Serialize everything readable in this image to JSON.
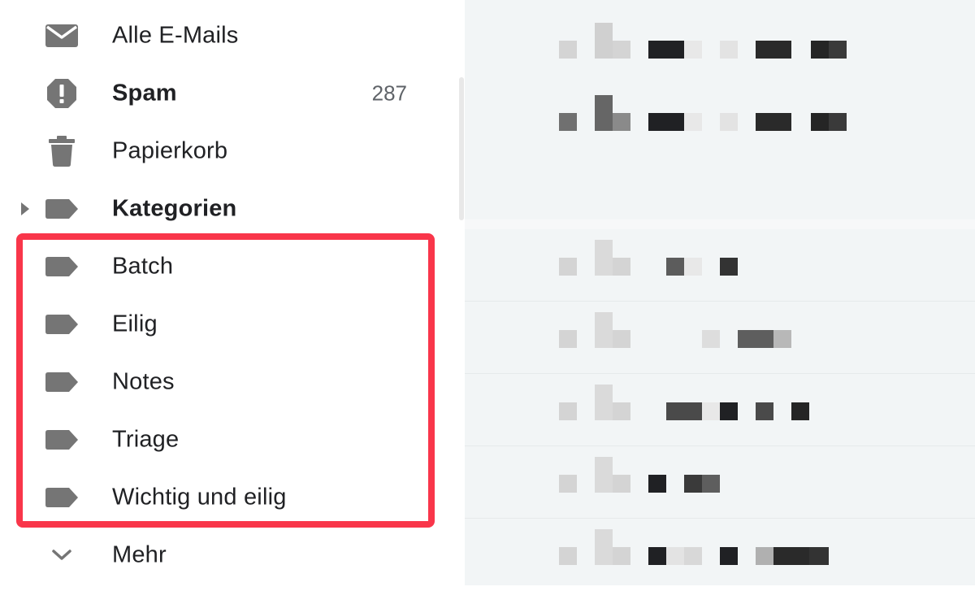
{
  "sidebar": {
    "items": [
      {
        "label": "Alle E-Mails",
        "icon": "mail-icon"
      },
      {
        "label": "Spam",
        "icon": "spam-icon",
        "count": "287",
        "bold": true
      },
      {
        "label": "Papierkorb",
        "icon": "trash-icon"
      },
      {
        "label": "Kategorien",
        "icon": "label-icon",
        "bold": true,
        "expandable": true
      },
      {
        "label": "Batch",
        "icon": "label-icon"
      },
      {
        "label": "Eilig",
        "icon": "label-icon"
      },
      {
        "label": "Notes",
        "icon": "label-icon"
      },
      {
        "label": "Triage",
        "icon": "label-icon"
      },
      {
        "label": "Wichtig und eilig",
        "icon": "label-icon"
      },
      {
        "label": "Mehr",
        "icon": "chevron-down-icon"
      }
    ]
  },
  "colors": {
    "highlight": "#f9364a",
    "icon": "#757575",
    "text": "#202124",
    "count": "#5f6368",
    "list_background": "#f2f5f6"
  }
}
